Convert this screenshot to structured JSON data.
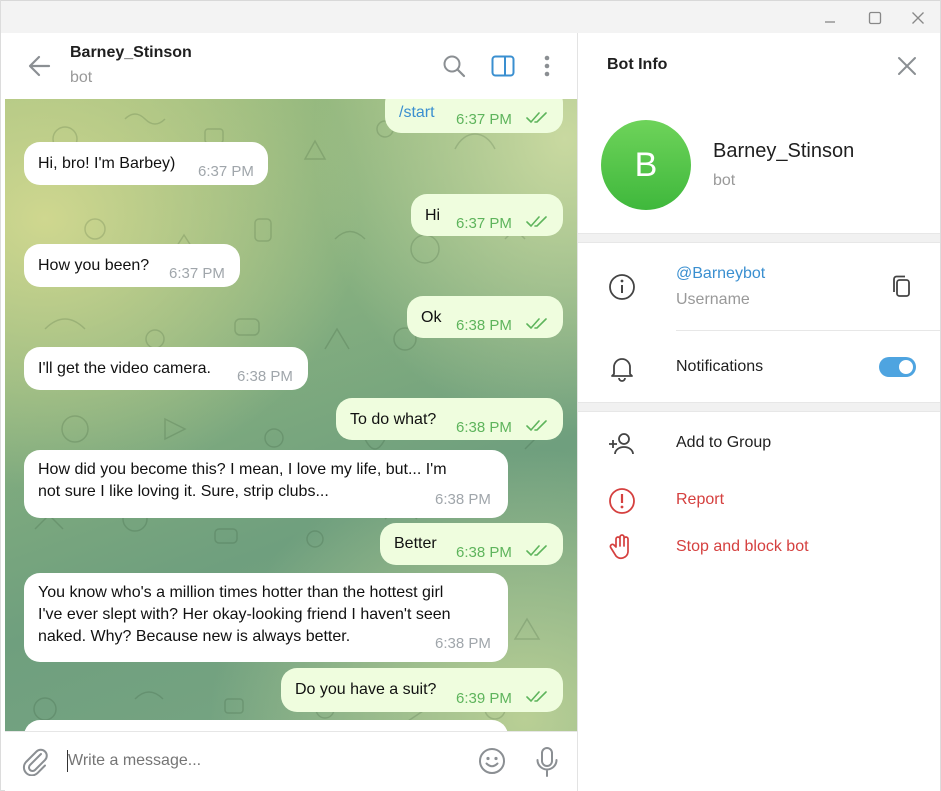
{
  "window": {
    "controls": [
      "minimize",
      "maximize",
      "close"
    ]
  },
  "chat": {
    "title": "Barney_Stinson",
    "subtitle": "bot",
    "messages": [
      {
        "dir": "out",
        "text": "/start",
        "time": "6:37 PM"
      },
      {
        "dir": "in",
        "text": "Hi, bro! I'm Barbey)",
        "time": "6:37 PM"
      },
      {
        "dir": "out",
        "text": "Hi",
        "time": "6:37 PM"
      },
      {
        "dir": "in",
        "text": "How you been?",
        "time": "6:37 PM"
      },
      {
        "dir": "out",
        "text": "Ok",
        "time": "6:38 PM"
      },
      {
        "dir": "in",
        "text": "I'll get the video camera.",
        "time": "6:38 PM"
      },
      {
        "dir": "out",
        "text": "To do what?",
        "time": "6:38 PM"
      },
      {
        "dir": "in",
        "line1": "How did you become this? I mean, I love my life, but... I'm",
        "line2": "not sure I like loving it. Sure, strip clubs...",
        "time": "6:38 PM"
      },
      {
        "dir": "out",
        "text": "Better",
        "time": "6:38 PM"
      },
      {
        "dir": "in",
        "line1": "You know who's a million times hotter than the hottest girl",
        "line2": "I've ever slept with? Her okay-looking friend I haven't seen",
        "line3": "naked. Why? Because new is always better.",
        "time": "6:38 PM"
      },
      {
        "dir": "out",
        "text": "Do you have a suit?",
        "time": "6:39 PM"
      }
    ],
    "composer": {
      "placeholder": "Write a message..."
    }
  },
  "info": {
    "title": "Bot Info",
    "avatar_letter": "B",
    "name": "Barney_Stinson",
    "subtitle": "bot",
    "username": "@Barneybot",
    "username_label": "Username",
    "notifications_label": "Notifications",
    "notifications_on": true,
    "add_to_group": "Add to Group",
    "report": "Report",
    "stop_block": "Stop and block bot"
  },
  "colors": {
    "accent": "#4ea4e0",
    "outgoing_bubble": "#effdde",
    "danger": "#d5403f",
    "avatar": "#4cc343"
  }
}
